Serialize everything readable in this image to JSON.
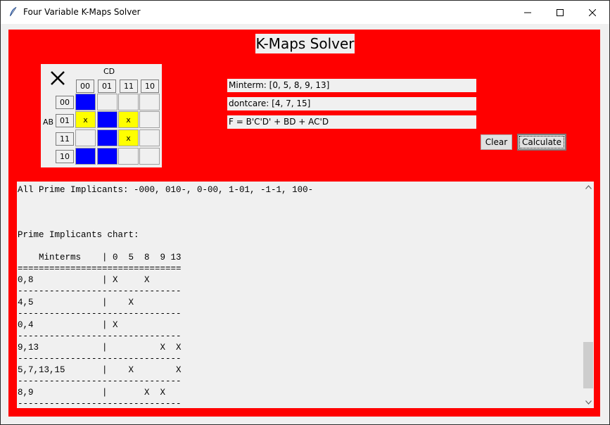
{
  "window": {
    "title": "Four Variable K-Maps Solver"
  },
  "app": {
    "title": "K-Maps Solver"
  },
  "kmap": {
    "cd_label": "CD",
    "ab_label": "AB",
    "col_headers": [
      "00",
      "01",
      "11",
      "10"
    ],
    "row_headers": [
      "00",
      "01",
      "11",
      "10"
    ],
    "cells": [
      [
        {
          "v": "1",
          "color": "blue"
        },
        {
          "v": "",
          "color": "empty"
        },
        {
          "v": "",
          "color": "empty"
        },
        {
          "v": "",
          "color": "empty"
        }
      ],
      [
        {
          "v": "x",
          "color": "yellow"
        },
        {
          "v": "1",
          "color": "blue"
        },
        {
          "v": "x",
          "color": "yellow"
        },
        {
          "v": "",
          "color": "empty"
        }
      ],
      [
        {
          "v": "",
          "color": "empty"
        },
        {
          "v": "1",
          "color": "blue"
        },
        {
          "v": "x",
          "color": "yellow"
        },
        {
          "v": "",
          "color": "empty"
        }
      ],
      [
        {
          "v": "1",
          "color": "blue"
        },
        {
          "v": "1",
          "color": "blue"
        },
        {
          "v": "",
          "color": "empty"
        },
        {
          "v": "",
          "color": "empty"
        }
      ]
    ]
  },
  "fields": {
    "minterm": "Minterm: [0, 5, 8, 9, 13]",
    "dontcare": "dontcare: [4, 7, 15]",
    "result": "F = B'C'D' + BD + AC'D"
  },
  "buttons": {
    "clear": "Clear",
    "calculate": "Calculate"
  },
  "output": {
    "lines": [
      "All Prime Implicants: -000, 010-, 0-00, 1-01, -1-1, 100-",
      "",
      "",
      "",
      "Prime Implicants chart:",
      "",
      "    Minterms    | 0  5  8  9 13",
      "===============================",
      "0,8             | X     X",
      "-------------------------------",
      "4,5             |    X",
      "-------------------------------",
      "0,4             | X",
      "-------------------------------",
      "9,13            |          X  X",
      "-------------------------------",
      "5,7,13,15       |    X        X",
      "-------------------------------",
      "8,9             |       X  X",
      "-------------------------------"
    ]
  },
  "colors": {
    "background": "#ff0000",
    "cell_one": "#0000ff",
    "cell_dontcare": "#ffff00"
  }
}
